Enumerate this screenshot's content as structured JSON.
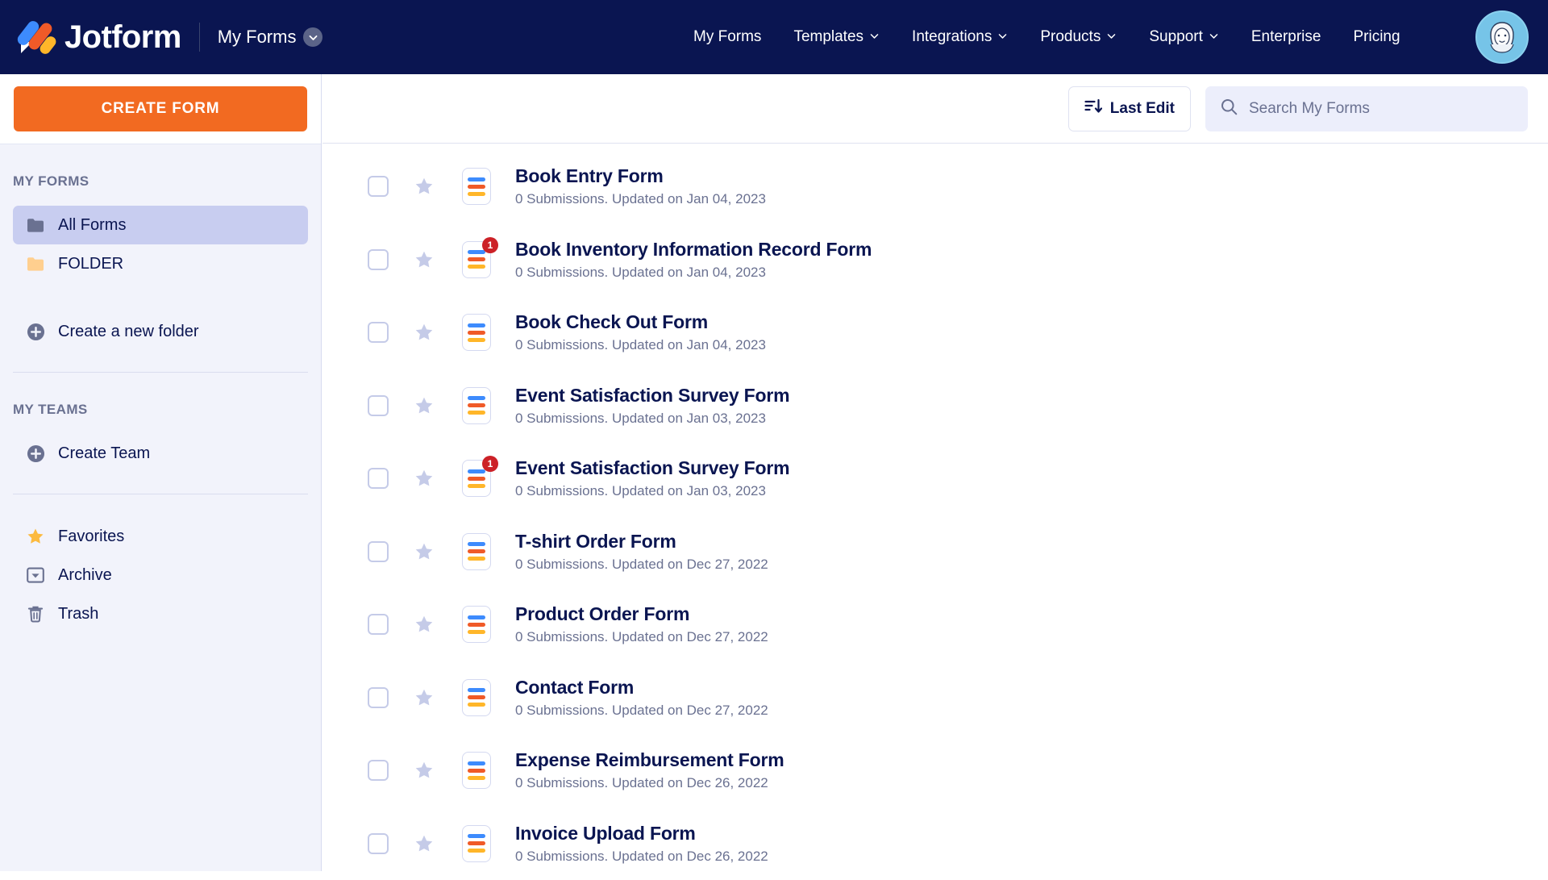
{
  "header": {
    "brand": "Jotform",
    "workspace_label": "My Forms",
    "workspace_chevron_icon": "chevron-down-icon",
    "logo_icon": "jotform-logo-icon",
    "nav": [
      {
        "label": "My Forms",
        "has_chevron": false
      },
      {
        "label": "Templates",
        "has_chevron": true
      },
      {
        "label": "Integrations",
        "has_chevron": true
      },
      {
        "label": "Products",
        "has_chevron": true
      },
      {
        "label": "Support",
        "has_chevron": true
      },
      {
        "label": "Enterprise",
        "has_chevron": false
      },
      {
        "label": "Pricing",
        "has_chevron": false
      }
    ],
    "avatar_icon": "user-avatar"
  },
  "sidebar": {
    "create_form_label": "CREATE FORM",
    "my_forms_heading": "MY FORMS",
    "folders": [
      {
        "label": "All Forms",
        "icon": "folder-icon",
        "active": true
      },
      {
        "label": "FOLDER",
        "icon": "folder-icon",
        "active": false
      }
    ],
    "create_folder": {
      "label": "Create a new folder",
      "icon": "plus-circle-icon"
    },
    "my_teams_heading": "MY TEAMS",
    "create_team": {
      "label": "Create Team",
      "icon": "plus-circle-icon"
    },
    "utility": [
      {
        "label": "Favorites",
        "icon": "star-icon"
      },
      {
        "label": "Archive",
        "icon": "archive-icon"
      },
      {
        "label": "Trash",
        "icon": "trash-icon"
      }
    ]
  },
  "toolbar": {
    "sort_label": "Last Edit",
    "sort_icon": "sort-descending-icon",
    "search_icon": "search-icon",
    "search_placeholder": "Search My Forms",
    "search_value": ""
  },
  "colors": {
    "header_bg": "#0a1551",
    "accent_orange": "#f26a21",
    "sidebar_bg": "#f2f3fb",
    "active_item_bg": "#c8cdf0",
    "badge_red": "#cc2127",
    "icon_blue": "#3d8bfd",
    "icon_orange": "#f05a28",
    "icon_yellow": "#ffb629",
    "text_dark": "#0a1551",
    "text_muted": "#6a7191"
  },
  "forms": [
    {
      "title": "Book Entry Form",
      "meta": "0 Submissions. Updated on Jan 04, 2023",
      "badge": null,
      "starred": false,
      "selected": false
    },
    {
      "title": "Book Inventory Information Record Form",
      "meta": "0 Submissions. Updated on Jan 04, 2023",
      "badge": "1",
      "starred": false,
      "selected": false
    },
    {
      "title": "Book Check Out Form",
      "meta": "0 Submissions. Updated on Jan 04, 2023",
      "badge": null,
      "starred": false,
      "selected": false
    },
    {
      "title": "Event Satisfaction Survey Form",
      "meta": "0 Submissions. Updated on Jan 03, 2023",
      "badge": null,
      "starred": false,
      "selected": false
    },
    {
      "title": "Event Satisfaction Survey Form",
      "meta": "0 Submissions. Updated on Jan 03, 2023",
      "badge": "1",
      "starred": false,
      "selected": false
    },
    {
      "title": "T-shirt Order Form",
      "meta": "0 Submissions. Updated on Dec 27, 2022",
      "badge": null,
      "starred": false,
      "selected": false
    },
    {
      "title": "Product Order Form",
      "meta": "0 Submissions. Updated on Dec 27, 2022",
      "badge": null,
      "starred": false,
      "selected": false
    },
    {
      "title": "Contact Form",
      "meta": "0 Submissions. Updated on Dec 27, 2022",
      "badge": null,
      "starred": false,
      "selected": false
    },
    {
      "title": "Expense Reimbursement Form",
      "meta": "0 Submissions. Updated on Dec 26, 2022",
      "badge": null,
      "starred": false,
      "selected": false
    },
    {
      "title": "Invoice Upload Form",
      "meta": "0 Submissions. Updated on Dec 26, 2022",
      "badge": null,
      "starred": false,
      "selected": false
    }
  ]
}
